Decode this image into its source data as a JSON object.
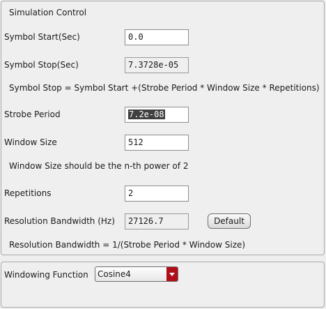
{
  "simulation_control": {
    "title": "Simulation Control",
    "symbol_start": {
      "label": "Symbol Start(Sec)",
      "value": "0.0"
    },
    "symbol_stop": {
      "label": "Symbol Stop(Sec)",
      "value": "7.3728e-05"
    },
    "symbol_stop_note": "Symbol Stop = Symbol Start +(Strobe Period * Window Size * Repetitions)",
    "strobe_period": {
      "label": "Strobe Period",
      "value": "7.2e-08"
    },
    "window_size": {
      "label": "Window Size",
      "value": "512"
    },
    "window_size_note": "Window Size should be the n-th power of 2",
    "repetitions": {
      "label": "Repetitions",
      "value": "2"
    },
    "resolution_bandwidth": {
      "label": "Resolution Bandwidth (Hz)",
      "value": "27126.7"
    },
    "default_button": "Default",
    "resolution_note": "Resolution Bandwidth = 1/(Strobe Period * Window Size)"
  },
  "windowing": {
    "label": "Windowing Function",
    "selected": "Cosine4"
  },
  "colors": {
    "selection_highlight": "#3f3f3f",
    "dropdown_arrow": "#b00e18"
  }
}
